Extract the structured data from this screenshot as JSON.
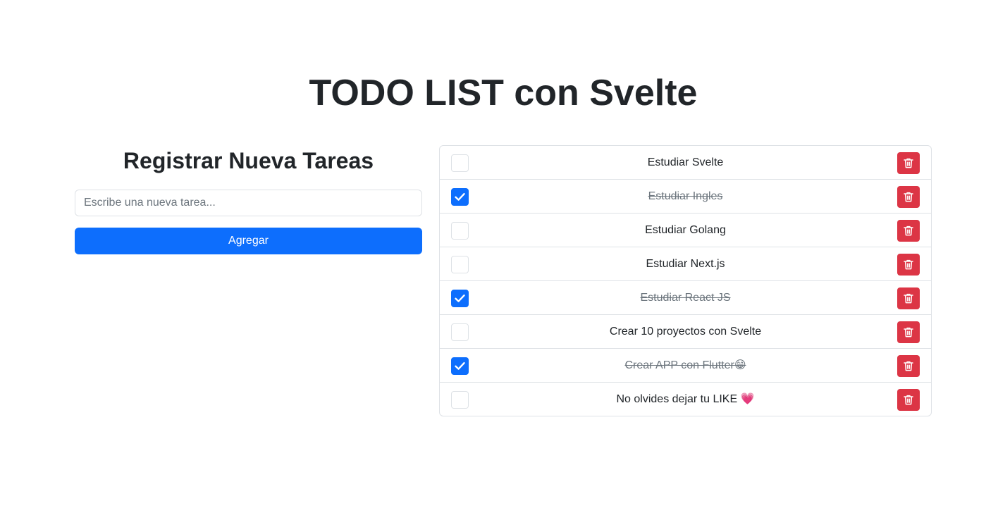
{
  "header": {
    "title": "TODO LIST con Svelte"
  },
  "form": {
    "title": "Registrar Nueva Tareas",
    "placeholder": "Escribe una nueva tarea...",
    "value": "",
    "add_label": "Agregar"
  },
  "todos": [
    {
      "text": "Estudiar Svelte",
      "done": false
    },
    {
      "text": "Estudiar Ingles",
      "done": true
    },
    {
      "text": "Estudiar Golang",
      "done": false
    },
    {
      "text": "Estudiar Next.js",
      "done": false
    },
    {
      "text": "Estudiar React JS",
      "done": true
    },
    {
      "text": "Crear 10 proyectos con Svelte",
      "done": false
    },
    {
      "text": "Crear APP con Flutter😁",
      "done": true
    },
    {
      "text": "No olvides dejar tu LIKE 💗",
      "done": false
    }
  ],
  "icons": {
    "check": "check-icon",
    "delete": "trash-icon"
  },
  "colors": {
    "primary": "#0d6efd",
    "danger": "#dc3545",
    "text": "#212529",
    "muted": "#6c757d",
    "border": "#dee2e6"
  }
}
